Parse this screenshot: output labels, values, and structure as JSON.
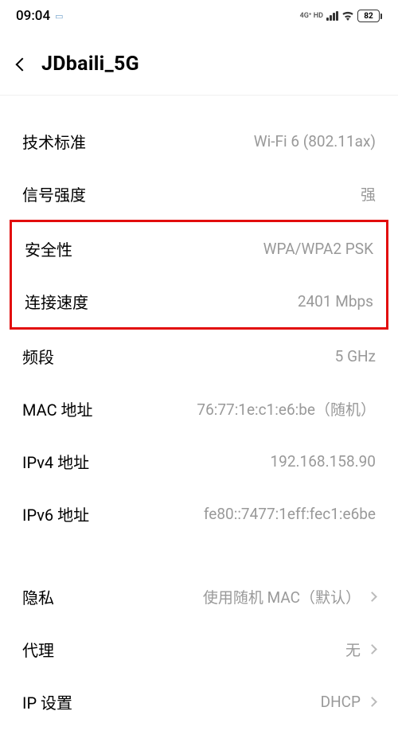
{
  "status": {
    "time": "09:04",
    "network_label": "4G⁺ HD",
    "battery_level": "82"
  },
  "header": {
    "title": "JDbaili_5G"
  },
  "details": {
    "tech_standard": {
      "label": "技术标准",
      "value": "Wi-Fi 6 (802.11ax)"
    },
    "signal_strength": {
      "label": "信号强度",
      "value": "强"
    },
    "security": {
      "label": "安全性",
      "value": "WPA/WPA2 PSK"
    },
    "link_speed": {
      "label": "连接速度",
      "value": "2401 Mbps"
    },
    "band": {
      "label": "频段",
      "value": "5 GHz"
    },
    "mac_address": {
      "label": "MAC 地址",
      "value": "76:77:1e:c1:e6:be（随机）"
    },
    "ipv4_address": {
      "label": "IPv4 地址",
      "value": "192.168.158.90"
    },
    "ipv6_address": {
      "label": "IPv6 地址",
      "value": "fe80::7477:1eff:fec1:e6be"
    }
  },
  "settings": {
    "privacy": {
      "label": "隐私",
      "value": "使用随机 MAC（默认）"
    },
    "proxy": {
      "label": "代理",
      "value": "无"
    },
    "ip_settings": {
      "label": "IP 设置",
      "value": "DHCP"
    }
  }
}
